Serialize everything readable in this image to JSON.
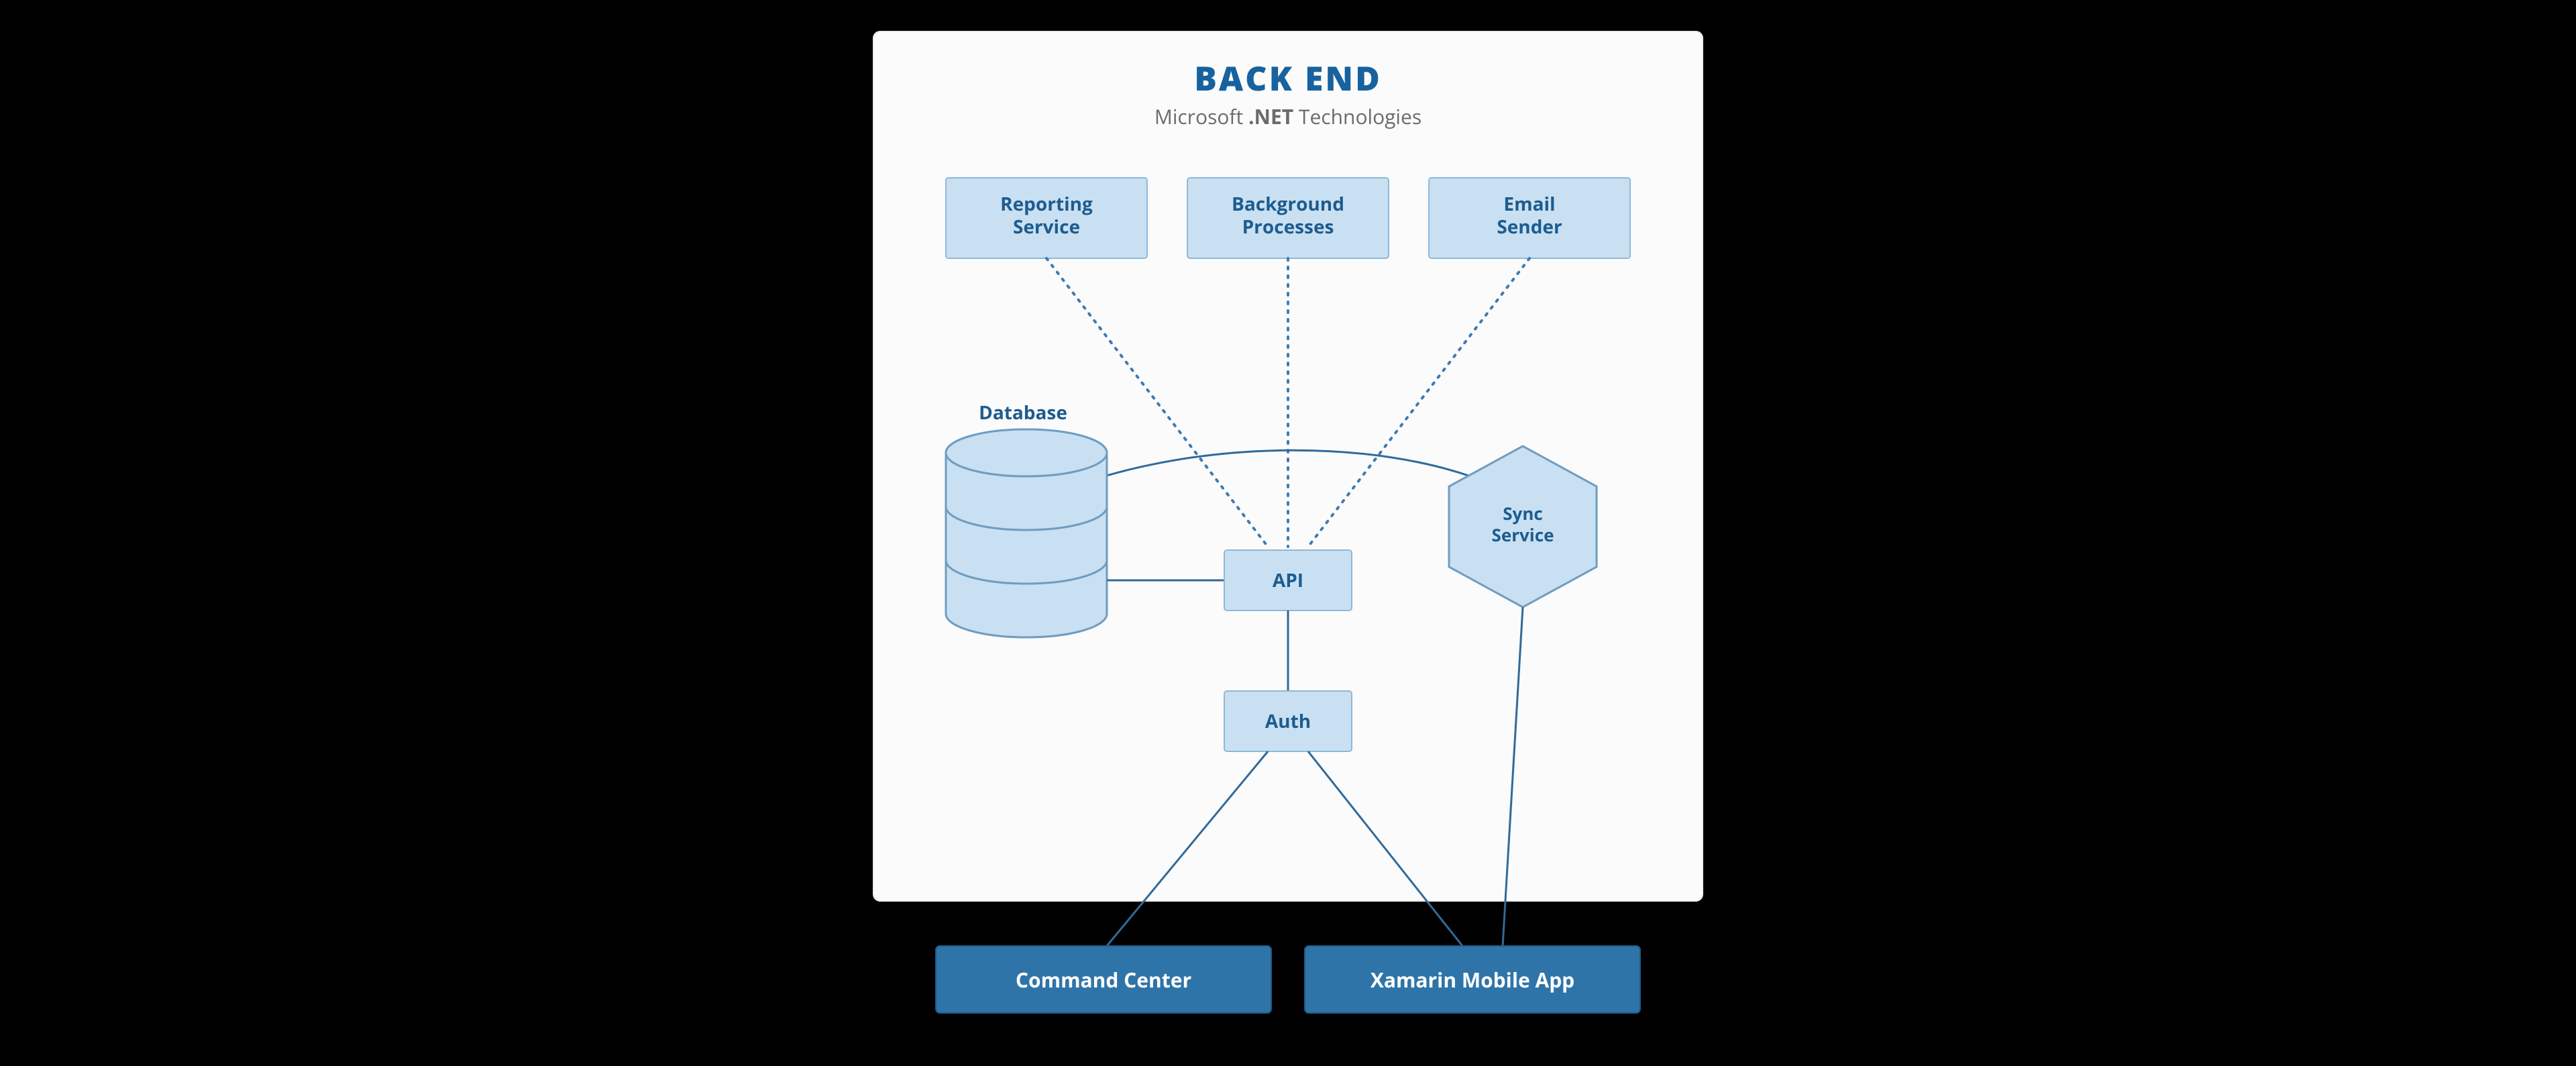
{
  "title": "BACK END",
  "subtitle_prefix": "Microsoft ",
  "subtitle_bold": ".NET",
  "subtitle_suffix": " Technologies",
  "nodes": {
    "reporting": {
      "line1": "Reporting",
      "line2": "Service"
    },
    "background": {
      "line1": "Background",
      "line2": "Processes"
    },
    "email": {
      "line1": "Email",
      "line2": "Sender"
    },
    "database": "Database",
    "sync": {
      "line1": "Sync",
      "line2": "Service"
    },
    "api": "API",
    "auth": "Auth",
    "command_center": "Command Center",
    "mobile_app": "Xamarin Mobile App"
  },
  "diagram": {
    "description": "Architecture diagram of a .NET back end. Top-row services (Reporting Service, Background Processes, Email Sender) connect via dotted lines to an API box. A Database cylinder connects to the API and (over a curved line) to a Sync Service hexagon. API connects down to Auth. Auth connects to two front-end boxes: Command Center and Xamarin Mobile App. Sync Service also connects to Xamarin Mobile App.",
    "edges": [
      {
        "from": "reporting",
        "to": "api",
        "style": "dotted"
      },
      {
        "from": "background",
        "to": "api",
        "style": "dotted"
      },
      {
        "from": "email",
        "to": "api",
        "style": "dotted"
      },
      {
        "from": "database",
        "to": "api",
        "style": "solid"
      },
      {
        "from": "database",
        "to": "sync",
        "style": "solid_curved"
      },
      {
        "from": "api",
        "to": "auth",
        "style": "solid"
      },
      {
        "from": "auth",
        "to": "command_center",
        "style": "solid"
      },
      {
        "from": "auth",
        "to": "mobile_app",
        "style": "solid"
      },
      {
        "from": "sync",
        "to": "mobile_app",
        "style": "solid"
      }
    ]
  }
}
